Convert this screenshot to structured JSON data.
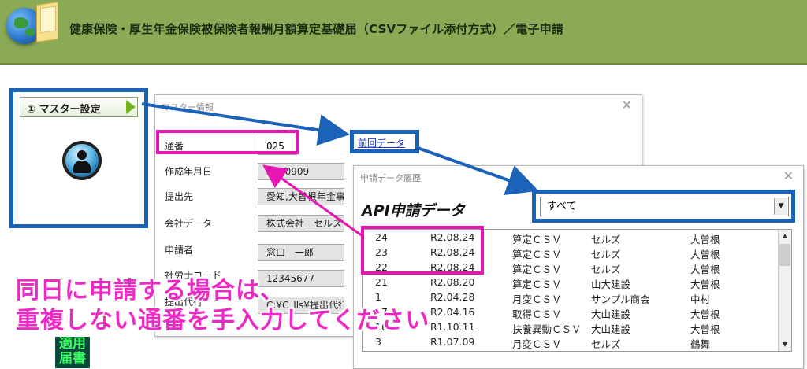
{
  "header": {
    "title": "健康保険・厚生年金保険被保険者報酬月額算定基礎届（CSVファイル添付方式）／電子申請"
  },
  "master": {
    "button_label": "① マスター設定"
  },
  "master_window": {
    "title": "マスター情報",
    "link_label": "前回データ",
    "fields": {
      "tsuuban": {
        "label": "通番",
        "value": "025"
      },
      "sakusei": {
        "label": "作成年月日",
        "value": "R020909"
      },
      "teishutsusaki": {
        "label": "提出先",
        "value": "愛知,大曽根年金事務所"
      },
      "kaisha": {
        "label": "会社データ",
        "value": "株式会社　セルズ"
      },
      "shinseisha": {
        "label": "申請者",
        "value": "窓口　一郎"
      },
      "code": {
        "label": "社労士コード",
        "value": "12345677"
      },
      "daikou": {
        "label": "提出代行",
        "value": "C:¥C_lls¥提出代行"
      }
    }
  },
  "history_window": {
    "title": "申請データ履歴",
    "api_title": "API申請データ",
    "filter_value": "すべて",
    "rows": [
      {
        "no": "24",
        "date": "R2.08.24",
        "type": "算定ＣＳＶ",
        "company": "セルズ",
        "office": "大曽根"
      },
      {
        "no": "23",
        "date": "R2.08.24",
        "type": "算定ＣＳＶ",
        "company": "セルズ",
        "office": "大曽根"
      },
      {
        "no": "22",
        "date": "R2.08.24",
        "type": "算定ＣＳＶ",
        "company": "セルズ",
        "office": "大曽根"
      },
      {
        "no": "21",
        "date": "R2.08.20",
        "type": "算定ＣＳＶ",
        "company": "山大建設",
        "office": "大曽根"
      },
      {
        "no": "1",
        "date": "R2.04.28",
        "type": "月変ＣＳＶ",
        "company": "サンプル商会",
        "office": "中村"
      },
      {
        "no": "17",
        "date": "R2.04.16",
        "type": "取得ＣＳＶ",
        "company": "大山建設",
        "office": "大曽根"
      },
      {
        "no": "16",
        "date": "R1.10.11",
        "type": "扶養異動ＣＳＶ",
        "company": "大山建設",
        "office": "大曽根"
      },
      {
        "no": "3",
        "date": "R1.07.09",
        "type": "月変ＣＳＶ",
        "company": "セルズ",
        "office": "鶴舞"
      }
    ]
  },
  "annotation": {
    "line1": "同日に申請する場合は、",
    "line2": "重複しない通番を手入力してください"
  },
  "side_badge": {
    "line1": "適用",
    "line2": "届書"
  },
  "colors": {
    "header_bg": "#8aaa55",
    "highlight_blue": "#1a63b8",
    "highlight_magenta": "#e815b4",
    "annotation_text": "#ec2bc4"
  }
}
